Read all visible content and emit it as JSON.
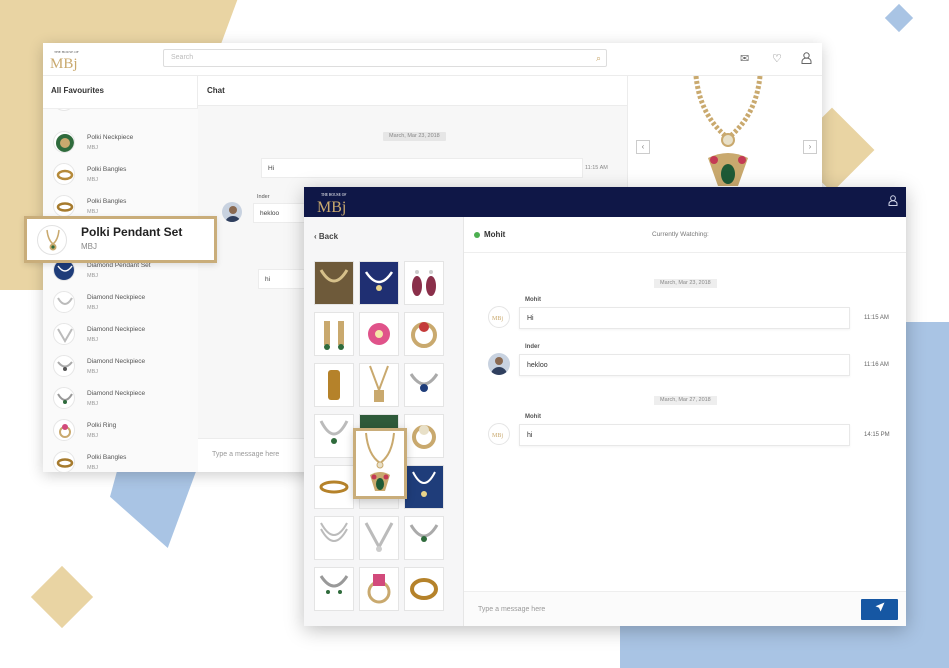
{
  "brand": {
    "logo_top": "THE HOUSE OF",
    "logo_main": "MBj",
    "logo_sub": "SINCE 1871"
  },
  "colors": {
    "gold": "#c9ad7a",
    "navy": "#0f1747",
    "send": "#1657a3",
    "online": "#4caf50"
  },
  "back_window": {
    "search_placeholder": "Search",
    "header_icons": [
      "mail-icon",
      "heart-icon",
      "user-icon"
    ],
    "sidebar_title": "All Favourites",
    "items": [
      {
        "name": "Polki Neckpiece",
        "sub": "MBJ"
      },
      {
        "name": "Polki Bangles",
        "sub": "MBJ"
      },
      {
        "name": "Polki Bangles",
        "sub": "MBJ"
      },
      {
        "name": "Diamond Pendant Set",
        "sub": "MBJ"
      },
      {
        "name": "Diamond Neckpiece",
        "sub": "MBJ"
      },
      {
        "name": "Diamond Neckpiece",
        "sub": "MBJ"
      },
      {
        "name": "Diamond Neckpiece",
        "sub": "MBJ"
      },
      {
        "name": "Diamond Neckpiece",
        "sub": "MBJ"
      },
      {
        "name": "Polki Ring",
        "sub": "MBJ"
      },
      {
        "name": "Polki Bangles",
        "sub": "MBJ"
      }
    ],
    "chat_title": "Chat",
    "date": "March, Mar 23, 2018",
    "msg1": {
      "text": "Hi",
      "time": "11:15 AM"
    },
    "msg2": {
      "sender": "Inder",
      "text": "hekloo"
    },
    "msg3": {
      "text": "hi"
    },
    "type_placeholder": "Type a message here"
  },
  "callout": {
    "title": "Polki Pendant Set",
    "sub": "MBJ"
  },
  "front_window": {
    "back_label": "Back",
    "contact": "Mohit",
    "currently_watching": "Currently Watching:",
    "date1": "March, Mar 23, 2018",
    "date2": "March, Mar 27, 2018",
    "messages": [
      {
        "sender": "Mohit",
        "text": "Hi",
        "time": "11:15 AM"
      },
      {
        "sender": "Inder",
        "text": "hekloo",
        "time": "11:16 AM"
      },
      {
        "sender": "Mohit",
        "text": "hi",
        "time": "14:15 PM"
      }
    ],
    "type_placeholder": "Type a message here",
    "send_icon": "send-icon"
  }
}
